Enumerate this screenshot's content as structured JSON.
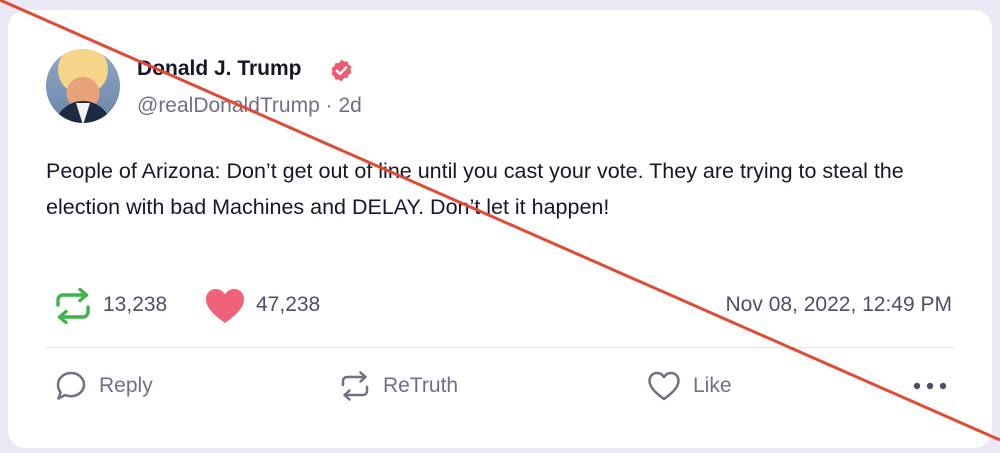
{
  "post": {
    "author_name": "Donald J. Trump",
    "handle": "@realDonaldTrump",
    "age": "2d",
    "handle_line": "@realDonaldTrump · 2d",
    "text": "People of Arizona: Don’t get out of line until you cast your vote. They are trying to steal the election with bad Machines and DELAY. Don’t let it happen!",
    "retruth_count": "13,238",
    "like_count": "47,238",
    "timestamp": "Nov 08, 2022, 12:49 PM"
  },
  "actions": {
    "reply_label": "Reply",
    "retruth_label": "ReTruth",
    "like_label": "Like"
  },
  "icons": {
    "verified": "verified-badge-icon",
    "retruth_stat": "retruth-icon",
    "like_stat": "heart-icon",
    "reply": "speech-bubble-icon",
    "retruth_action": "retruth-icon",
    "like_action": "heart-outline-icon",
    "more": "more-dots-icon"
  },
  "colors": {
    "background": "#e9e8f4",
    "card": "#ffffff",
    "verified": "#ee5a6f",
    "retruth_green": "#3bb54a",
    "heart_pink": "#f0627a",
    "strike_line": "#e24a35"
  }
}
